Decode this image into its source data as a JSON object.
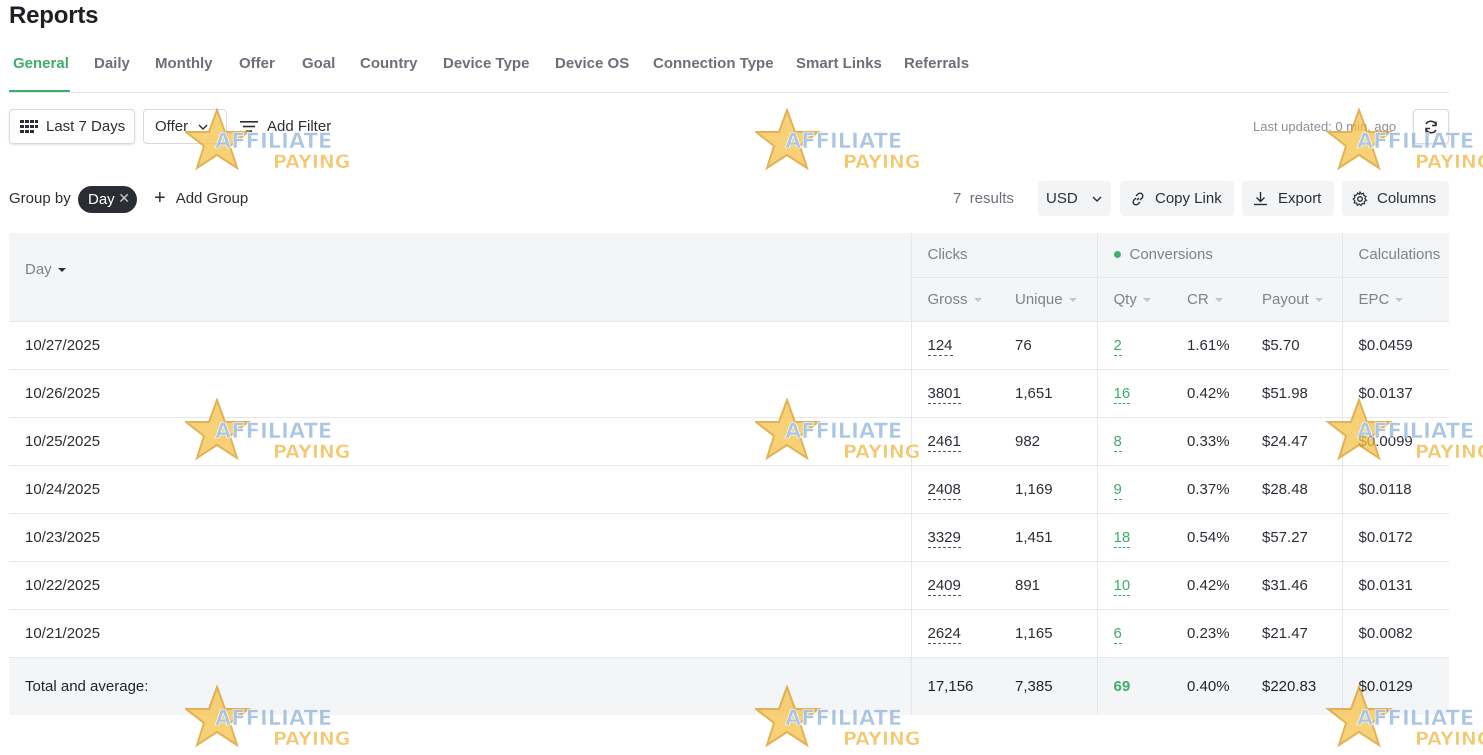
{
  "page": {
    "title": "Reports"
  },
  "tabs": [
    {
      "label": "General",
      "active": true
    },
    {
      "label": "Daily"
    },
    {
      "label": "Monthly"
    },
    {
      "label": "Offer"
    },
    {
      "label": "Goal"
    },
    {
      "label": "Country"
    },
    {
      "label": "Device Type"
    },
    {
      "label": "Device OS"
    },
    {
      "label": "Connection Type"
    },
    {
      "label": "Smart Links"
    },
    {
      "label": "Referrals"
    }
  ],
  "filters": {
    "date_range_label": "Last 7 Days",
    "offer_label": "Offer",
    "add_filter_label": "Add Filter",
    "last_updated": "Last updated: 0 min. ago"
  },
  "grouping": {
    "label": "Group by",
    "active_group": "Day",
    "add_group_label": "Add Group"
  },
  "toolbar": {
    "results_count": "7",
    "results_label": "results",
    "currency": "USD",
    "copy_link_label": "Copy Link",
    "export_label": "Export",
    "columns_label": "Columns"
  },
  "table": {
    "groups": {
      "clicks": "Clicks",
      "conversions": "Conversions",
      "calculations": "Calculations"
    },
    "columns": {
      "day": "Day",
      "gross": "Gross",
      "unique": "Unique",
      "qty": "Qty",
      "cr": "CR",
      "payout": "Payout",
      "epc": "EPC"
    },
    "rows": [
      {
        "day": "10/27/2025",
        "gross": "124",
        "unique": "76",
        "qty": "2",
        "cr": "1.61%",
        "payout": "$5.70",
        "epc": "$0.0459"
      },
      {
        "day": "10/26/2025",
        "gross": "3801",
        "unique": "1,651",
        "qty": "16",
        "cr": "0.42%",
        "payout": "$51.98",
        "epc": "$0.0137"
      },
      {
        "day": "10/25/2025",
        "gross": "2461",
        "unique": "982",
        "qty": "8",
        "cr": "0.33%",
        "payout": "$24.47",
        "epc": "$0.0099"
      },
      {
        "day": "10/24/2025",
        "gross": "2408",
        "unique": "1,169",
        "qty": "9",
        "cr": "0.37%",
        "payout": "$28.48",
        "epc": "$0.0118"
      },
      {
        "day": "10/23/2025",
        "gross": "3329",
        "unique": "1,451",
        "qty": "18",
        "cr": "0.54%",
        "payout": "$57.27",
        "epc": "$0.0172"
      },
      {
        "day": "10/22/2025",
        "gross": "2409",
        "unique": "891",
        "qty": "10",
        "cr": "0.42%",
        "payout": "$31.46",
        "epc": "$0.0131"
      },
      {
        "day": "10/21/2025",
        "gross": "2624",
        "unique": "1,165",
        "qty": "6",
        "cr": "0.23%",
        "payout": "$21.47",
        "epc": "$0.0082"
      }
    ],
    "totals": {
      "label": "Total and average:",
      "gross": "17,156",
      "unique": "7,385",
      "qty": "69",
      "cr": "0.40%",
      "payout": "$220.83",
      "epc": "$0.0129"
    }
  },
  "watermark": {
    "line1": "AFFILIATE",
    "line2": "PAYING"
  },
  "colors": {
    "accent": "#3fae6a",
    "header_bg": "#f4f5f7",
    "chip_bg": "#2a2d31"
  }
}
